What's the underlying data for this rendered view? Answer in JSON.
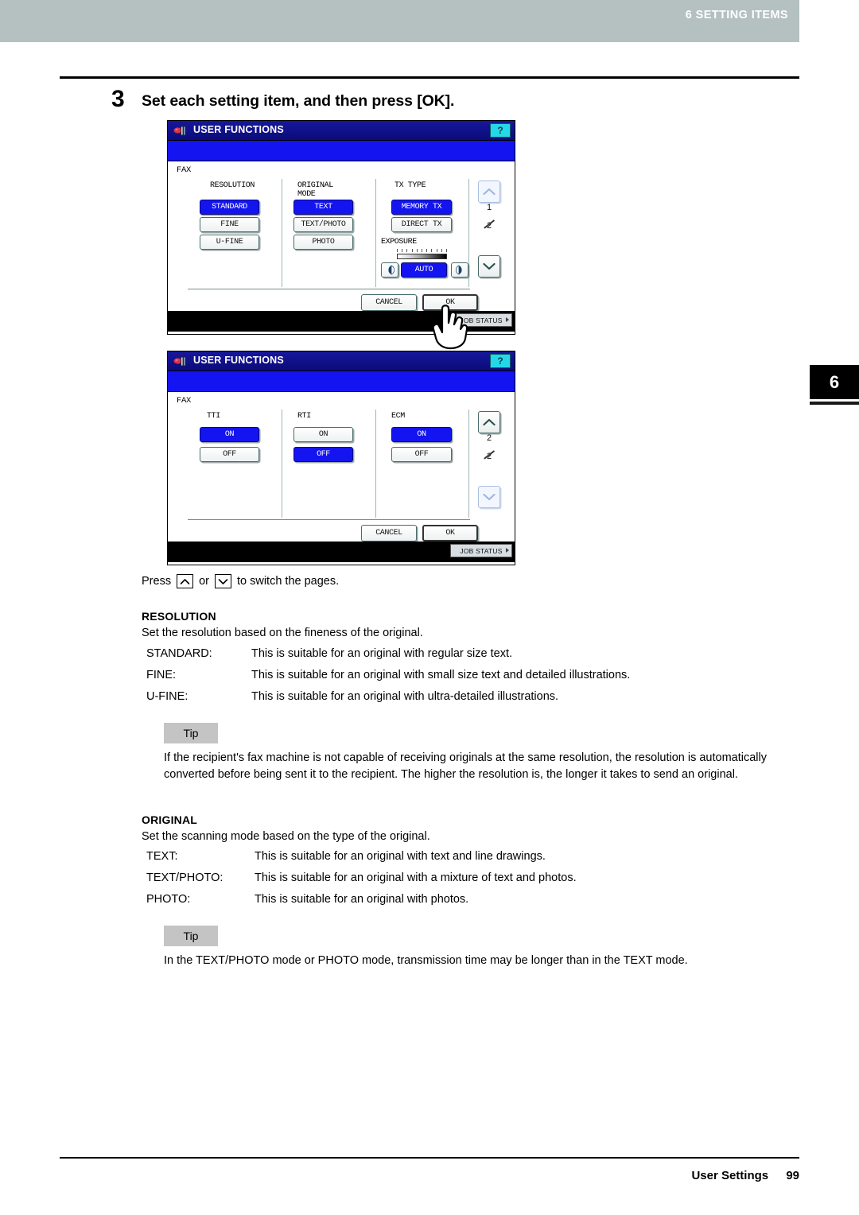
{
  "header": {
    "chapter_running_head": "6 SETTING ITEMS",
    "chapter_tab": "6",
    "header_bg": "#b5c0c0"
  },
  "step": {
    "number": "3",
    "title": "Set each setting item, and then press [OK]."
  },
  "panels": [
    {
      "title": "USER FUNCTIONS",
      "title_icon": "user-functions-icon",
      "help_button": "?",
      "section_label": "FAX",
      "page_indicator": {
        "current": "1",
        "total": "2"
      },
      "up_arrow_state": "disabled",
      "down_arrow_state": "enabled",
      "columns": [
        {
          "title": "RESOLUTION",
          "buttons": [
            {
              "label": "STANDARD",
              "selected": true
            },
            {
              "label": "FINE",
              "selected": false
            },
            {
              "label": "U-FINE",
              "selected": false
            }
          ]
        },
        {
          "title": "ORIGINAL\nMODE",
          "buttons": [
            {
              "label": "TEXT",
              "selected": true
            },
            {
              "label": "TEXT/PHOTO",
              "selected": false
            },
            {
              "label": "PHOTO",
              "selected": false
            }
          ]
        },
        {
          "title": "TX TYPE",
          "buttons": [
            {
              "label": "MEMORY TX",
              "selected": true
            },
            {
              "label": "DIRECT TX",
              "selected": false
            }
          ]
        }
      ],
      "exposure": {
        "label": "EXPOSURE",
        "value": "AUTO",
        "decrease_icon": "exposure-lighter-icon",
        "increase_icon": "exposure-darker-icon"
      },
      "cancel_label": "CANCEL",
      "ok_label": "OK",
      "job_status_label": "JOB STATUS",
      "cursor": "hand-pointer"
    },
    {
      "title": "USER FUNCTIONS",
      "title_icon": "user-functions-icon",
      "help_button": "?",
      "section_label": "FAX",
      "page_indicator": {
        "current": "2",
        "total": "2"
      },
      "up_arrow_state": "enabled",
      "down_arrow_state": "disabled",
      "columns": [
        {
          "title": "TTI",
          "buttons": [
            {
              "label": "ON",
              "selected": true
            },
            {
              "label": "OFF",
              "selected": false
            }
          ]
        },
        {
          "title": "RTI",
          "buttons": [
            {
              "label": "ON",
              "selected": false
            },
            {
              "label": "OFF",
              "selected": true
            }
          ]
        },
        {
          "title": "ECM",
          "buttons": [
            {
              "label": "ON",
              "selected": true
            },
            {
              "label": "OFF",
              "selected": false
            }
          ]
        }
      ],
      "cancel_label": "CANCEL",
      "ok_label": "OK",
      "job_status_label": "JOB STATUS"
    }
  ],
  "press_line": {
    "prefix": "Press",
    "up_icon": "chevron-up-icon",
    "middle": "or",
    "down_icon": "chevron-down-icon",
    "suffix": "to switch the pages."
  },
  "resolution_section": {
    "heading": "RESOLUTION",
    "intro": "Set the resolution based on the fineness of the original.",
    "items": [
      {
        "term": "STANDARD:",
        "desc": "This is suitable for an original with regular size text."
      },
      {
        "term": "FINE:",
        "desc": "This is suitable for an original with small size text and detailed illustrations."
      },
      {
        "term": "U-FINE:",
        "desc": "This is suitable for an original with ultra-detailed illustrations."
      }
    ]
  },
  "tip1": {
    "label": "Tip",
    "text": "If the recipient's fax machine is not capable of receiving originals at the same resolution, the resolution is automatically converted before being sent it to the recipient. The higher the resolution is, the longer it takes to send an original."
  },
  "original_section": {
    "heading": "ORIGINAL",
    "intro": "Set the scanning mode based on the type of the original.",
    "items": [
      {
        "term": "TEXT:",
        "desc": "This is suitable for an original with text and line drawings."
      },
      {
        "term": "TEXT/PHOTO:",
        "desc": "This is suitable for an original with a mixture of text and photos."
      },
      {
        "term": "PHOTO:",
        "desc": "This is suitable for an original with photos."
      }
    ]
  },
  "tip2": {
    "label": "Tip",
    "text": "In the TEXT/PHOTO mode or PHOTO mode, transmission time may be longer than in the TEXT mode."
  },
  "footer": {
    "section": "User Settings",
    "page_number": "99"
  }
}
